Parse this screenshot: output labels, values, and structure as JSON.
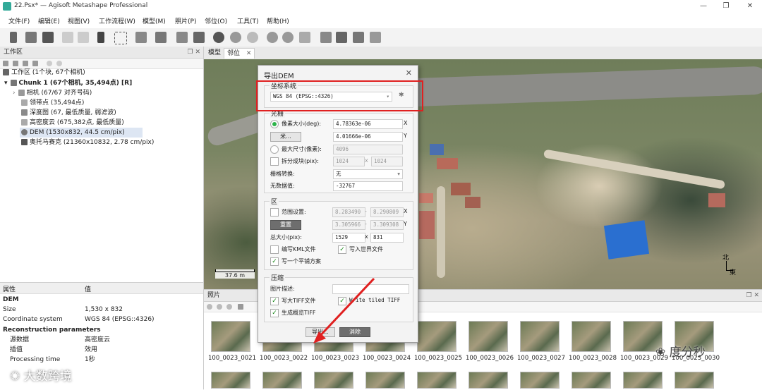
{
  "window": {
    "title": "22.Psx* — Agisoft Metashape Professional"
  },
  "menu": [
    "文件(F)",
    "编辑(E)",
    "视图(V)",
    "工作流程(W)",
    "模型(M)",
    "照片(P)",
    "邻位(O)",
    "工具(T)",
    "帮助(H)"
  ],
  "workspace": {
    "title": "工作区",
    "root": "工作区 (1个块, 67个相机)",
    "chunk": "Chunk 1 (67个相机, 35,494点) [R]",
    "items": [
      "相机 (67/67 对齐号码)",
      "领带点 (35,494点)",
      "深度图 (67, 最低质量, 弱滤波)",
      "高密度云 (675,382点, 最低质量)",
      "DEM (1530x832, 44.5 cm/pix)",
      "奥托马赛克 (21360x10832, 2.78 cm/pix)"
    ]
  },
  "properties": {
    "col_property": "属性",
    "col_value": "值",
    "section": "DEM",
    "rows": [
      {
        "k": "Size",
        "v": "1,530 x 832"
      },
      {
        "k": "Coordinate system",
        "v": "WGS 84 (EPSG::4326)"
      }
    ],
    "section2": "Reconstruction parameters",
    "rows2": [
      {
        "k": "源数据",
        "v": "高密度云"
      },
      {
        "k": "插值",
        "v": "效用"
      },
      {
        "k": "Processing time",
        "v": "1秒"
      }
    ]
  },
  "tabs": [
    "模型",
    "邻位"
  ],
  "map": {
    "scale": "37.6 m",
    "north": "北",
    "east": "東"
  },
  "photos": {
    "title": "照片",
    "labels": [
      "100_0023_0021",
      "100_0023_0022",
      "100_0023_0023",
      "100_0023_0024",
      "100_0023_0025",
      "100_0023_0026",
      "100_0023_0027",
      "100_0023_0028",
      "100_0023_0029",
      "100_0023_0030"
    ]
  },
  "dialog": {
    "title": "导出DEM",
    "crs_group": "坐标系统",
    "crs_value": "WGS 84 (EPSG::4326)",
    "raster_group": "光栅",
    "pixel_size_label": "像素大小(deg):",
    "pixel_x": "4.78363e-06",
    "pixel_y": "4.01666e-06",
    "axis_x": "X",
    "axis_y": "Y",
    "meter_btn": "米...",
    "max_dim_label": "最大尺寸(像素):",
    "max_dim": "4096",
    "split_label": "拆分成块(pix):",
    "split_w": "1024",
    "split_h": "1024",
    "times": "x",
    "raster_transform_label": "栅格转换:",
    "raster_transform": "无",
    "nodata_label": "无数据值:",
    "nodata": "-32767",
    "region_group": "区",
    "bounds_label": "范围设置:",
    "bx1": "8.283490",
    "bx2": "8.290809",
    "by1": "3.305966",
    "by2": "3.309308",
    "dash": "-",
    "reset_btn": "重置",
    "total_label": "总大小(pix):",
    "total_w": "1529",
    "total_h": "831",
    "kml_label": "编写KML文件",
    "world_label": "写入世界文件",
    "tile_label": "写一个平铺方案",
    "compress_group": "压缩",
    "desc_label": "图片描述:",
    "bigtiff_label": "写大TIFF文件",
    "tiled_label": "Write tiled TIFF",
    "overview_label": "生成概览TIFF",
    "export_btn": "导出...",
    "cancel_btn": "消除"
  },
  "watermarks": {
    "left": "大数跨境",
    "right": "度分秒"
  }
}
